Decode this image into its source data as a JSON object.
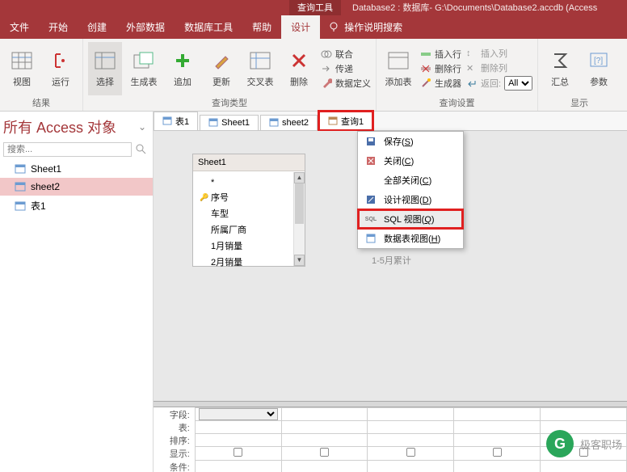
{
  "titlebar": {
    "tool": "查询工具",
    "title": "Database2 : 数据库- G:\\Documents\\Database2.accdb (Access"
  },
  "menu": {
    "items": [
      "文件",
      "开始",
      "创建",
      "外部数据",
      "数据库工具",
      "帮助",
      "设计"
    ],
    "active": 6,
    "search_hint": "操作说明搜索"
  },
  "ribbon": {
    "g1": {
      "view": "视图",
      "run": "运行",
      "label": "结果"
    },
    "g2": {
      "b": [
        "选择",
        "生成表",
        "追加",
        "更新",
        "交叉表",
        "删除"
      ],
      "small": [
        "联合",
        "传递",
        "数据定义"
      ],
      "label": "查询类型"
    },
    "g3": {
      "add": "添加表",
      "small": [
        "插入行",
        "删除行",
        "生成器"
      ],
      "small2": [
        "插入列",
        "删除列",
        "返回:"
      ],
      "return_val": "All",
      "label": "查询设置"
    },
    "g4": {
      "sum": "汇总",
      "param": "参数",
      "label": "显示"
    }
  },
  "nav": {
    "header": "所有 Access 对象",
    "search_placeholder": "搜索...",
    "items": [
      {
        "label": "Sheet1",
        "selected": false
      },
      {
        "label": "sheet2",
        "selected": true
      },
      {
        "label": "表1",
        "selected": false
      }
    ]
  },
  "tabs": [
    {
      "label": "表1",
      "icon": "table"
    },
    {
      "label": "Sheet1",
      "icon": "table"
    },
    {
      "label": "sheet2",
      "icon": "table"
    },
    {
      "label": "查询1",
      "icon": "query",
      "highlight": true
    }
  ],
  "fieldbox": {
    "caption": "Sheet1",
    "fields": [
      "*",
      "序号",
      "车型",
      "所属厂商",
      "1月销量",
      "2月销量"
    ]
  },
  "context": [
    {
      "label": "保存",
      "hot": "S",
      "icon": "save"
    },
    {
      "label": "关闭",
      "hot": "C",
      "icon": "close"
    },
    {
      "label": "全部关闭",
      "hot": "C",
      "icon": ""
    },
    {
      "label": "设计视图",
      "hot": "D",
      "icon": "design"
    },
    {
      "label": "SQL 视图",
      "hot": "Q",
      "icon": "sql",
      "highlight": true
    },
    {
      "label": "数据表视图",
      "hot": "H",
      "icon": "datasheet"
    }
  ],
  "hidden_label": "1-5月累计",
  "designgrid": {
    "rows": [
      "字段:",
      "表:",
      "排序:",
      "显示:",
      "条件:"
    ]
  },
  "watermark": "极客职场"
}
